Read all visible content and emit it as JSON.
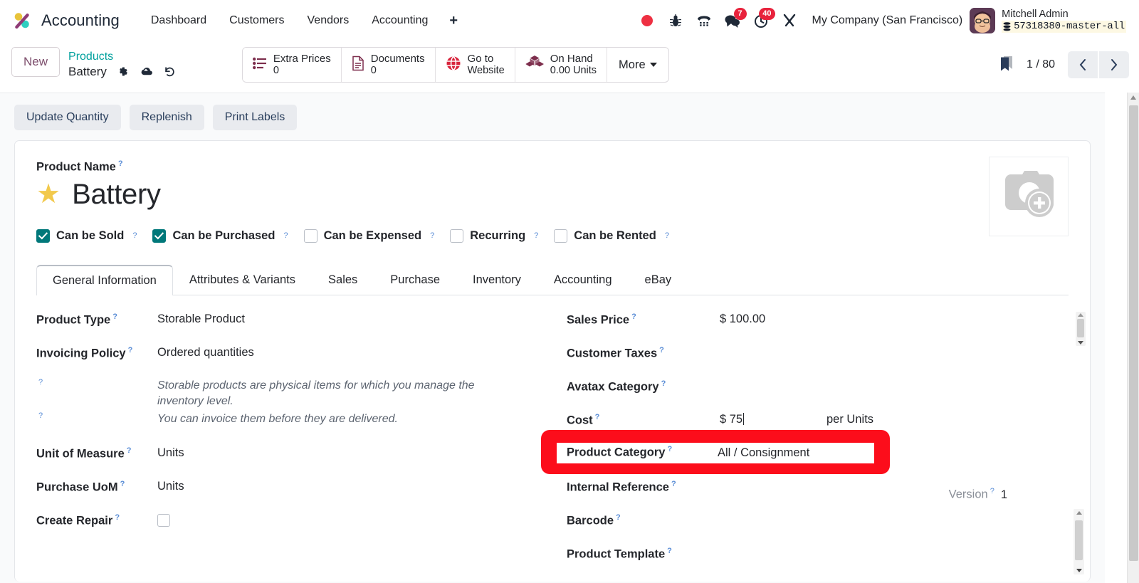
{
  "navbar": {
    "logo_icon": "odoo-logo-icon",
    "app_name": "Accounting",
    "menu": [
      {
        "label": "Dashboard"
      },
      {
        "label": "Customers"
      },
      {
        "label": "Vendors"
      },
      {
        "label": "Accounting"
      }
    ],
    "plus_label": "+",
    "sys_icons": [
      {
        "name": "record-dot-icon",
        "badge": ""
      },
      {
        "name": "bug-icon",
        "badge": ""
      },
      {
        "name": "dialpad-phone-icon",
        "badge": ""
      },
      {
        "name": "messages-icon",
        "badge": "7"
      },
      {
        "name": "activities-clock-icon",
        "badge": "40"
      },
      {
        "name": "tools-wrench-icon",
        "badge": ""
      }
    ],
    "company": "My Company (San Francisco)",
    "user_name": "Mitchell Admin",
    "user_db": "57318380-master-all",
    "db_icon": "database-icon"
  },
  "control_panel": {
    "new_label": "New",
    "breadcrumb_parent": "Products",
    "breadcrumb_current": "Battery",
    "record_icons": [
      "gear-icon",
      "cloud-upload-icon",
      "discard-undo-icon"
    ],
    "smart_buttons": [
      {
        "icon": "list-prices-icon",
        "label": "Extra Prices",
        "value": "0"
      },
      {
        "icon": "document-icon",
        "label": "Documents",
        "value": "0"
      },
      {
        "icon": "globe-website-icon",
        "label": "Go to",
        "value": "Website"
      },
      {
        "icon": "boxes-stock-icon",
        "label": "On Hand",
        "value": "0.00 Units"
      }
    ],
    "more_label": "More",
    "bookmark_icon": "bookmark-icon",
    "pager": "1 / 80",
    "prev_icon": "chevron-left-icon",
    "next_icon": "chevron-right-icon"
  },
  "statusbar": {
    "buttons": [
      {
        "label": "Update Quantity"
      },
      {
        "label": "Replenish"
      },
      {
        "label": "Print Labels"
      }
    ]
  },
  "sheet": {
    "product_name_label": "Product Name",
    "product_name": "Battery",
    "favorite_icon": "star-filled-icon",
    "image_placeholder_icon": "camera-add-photo-icon",
    "checkboxes": [
      {
        "label": "Can be Sold",
        "checked": true
      },
      {
        "label": "Can be Purchased",
        "checked": true
      },
      {
        "label": "Can be Expensed",
        "checked": false
      },
      {
        "label": "Recurring",
        "checked": false
      },
      {
        "label": "Can be Rented",
        "checked": false
      }
    ],
    "tabs": [
      {
        "label": "General Information",
        "active": true
      },
      {
        "label": "Attributes & Variants",
        "active": false
      },
      {
        "label": "Sales",
        "active": false
      },
      {
        "label": "Purchase",
        "active": false
      },
      {
        "label": "Inventory",
        "active": false
      },
      {
        "label": "Accounting",
        "active": false
      },
      {
        "label": "eBay",
        "active": false
      }
    ],
    "left_fields": [
      {
        "label": "Product Type",
        "value": "Storable Product",
        "type": "text"
      },
      {
        "label": "Invoicing Policy",
        "value": "Ordered quantities",
        "type": "text"
      },
      {
        "label": "",
        "value": "Storable products are physical items for which you manage the inventory level.",
        "type": "help"
      },
      {
        "label": "",
        "value": "You can invoice them before they are delivered.",
        "type": "help"
      },
      {
        "label": "Unit of Measure",
        "value": "Units",
        "type": "text"
      },
      {
        "label": "Purchase UoM",
        "value": "Units",
        "type": "text"
      },
      {
        "label": "Create Repair",
        "value": "",
        "type": "checkbox"
      }
    ],
    "right_fields": [
      {
        "label": "Sales Price",
        "value": "$ 100.00",
        "suffix": ""
      },
      {
        "label": "Customer Taxes",
        "value": "",
        "suffix": ""
      },
      {
        "label": "Avatax Category",
        "value": "",
        "suffix": ""
      },
      {
        "label": "Cost",
        "value": "$ 75",
        "suffix": "per Units"
      },
      {
        "label": "Product Category",
        "value": "All / Consignment",
        "suffix": ""
      },
      {
        "label": "Internal Reference",
        "value": "",
        "suffix": ""
      },
      {
        "label": "Barcode",
        "value": "",
        "suffix": ""
      },
      {
        "label": "Product Template",
        "value": "",
        "suffix": ""
      }
    ],
    "version_label": "Version",
    "version_value": "1"
  },
  "highlight": {
    "label": "Product Category",
    "value": "All / Consignment",
    "color": "#fc0d1b"
  },
  "colors": {
    "brand_purple": "#714B67",
    "teal": "#00A09D",
    "badge_red": "#e8223c",
    "checkbox_teal": "#00787a",
    "star_yellow": "#f2c94c",
    "highlight_red": "#fc0d1b"
  }
}
